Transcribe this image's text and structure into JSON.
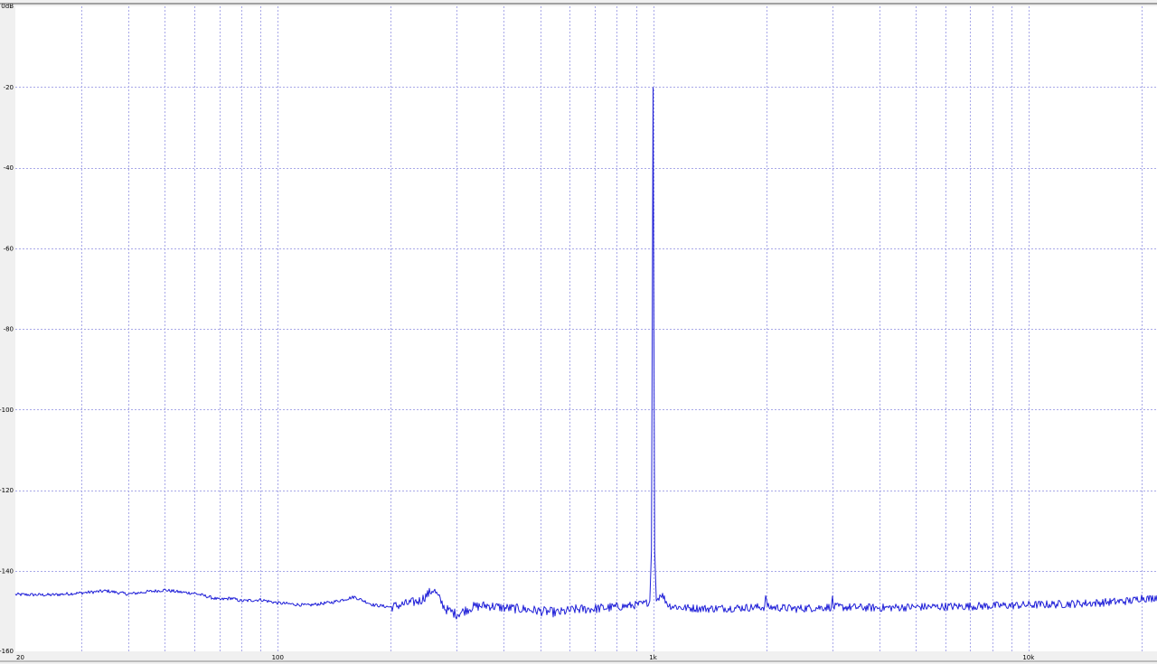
{
  "chart_data": {
    "type": "line",
    "title": "",
    "xlabel": "",
    "ylabel": "",
    "x_scale": "log",
    "xlim": [
      20,
      22000
    ],
    "ylim": [
      -160,
      0
    ],
    "x_ticks": [
      {
        "value": 20,
        "label": "20"
      },
      {
        "value": 100,
        "label": "100"
      },
      {
        "value": 1000,
        "label": "1k"
      },
      {
        "value": 10000,
        "label": "10k"
      }
    ],
    "y_ticks": [
      {
        "value": 0,
        "label": "0dB"
      },
      {
        "value": -20,
        "label": "-20"
      },
      {
        "value": -40,
        "label": "-40"
      },
      {
        "value": -60,
        "label": "-60"
      },
      {
        "value": -80,
        "label": "-80"
      },
      {
        "value": -100,
        "label": "-100"
      },
      {
        "value": -120,
        "label": "-120"
      },
      {
        "value": -140,
        "label": "-140"
      },
      {
        "value": -160,
        "label": "-160"
      }
    ],
    "grid": true,
    "colors": {
      "line": "#2020d8",
      "grid": "#a8a8e8",
      "plot_bg": "#ffffff",
      "frame_bg": "#f0f0f0"
    },
    "series": [
      {
        "values": [
          [
            20,
            -145.9
          ],
          [
            25,
            -146.0
          ],
          [
            30,
            -145.5
          ],
          [
            35,
            -145.0
          ],
          [
            40,
            -145.8
          ],
          [
            45,
            -145.2
          ],
          [
            50,
            -144.8
          ],
          [
            55,
            -145.3
          ],
          [
            60,
            -145.6
          ],
          [
            65,
            -146.4
          ],
          [
            70,
            -147.2
          ],
          [
            75,
            -146.8
          ],
          [
            80,
            -147.5
          ],
          [
            90,
            -147.2
          ],
          [
            100,
            -148.0
          ],
          [
            110,
            -148.3
          ],
          [
            120,
            -148.6
          ],
          [
            140,
            -147.8
          ],
          [
            160,
            -146.5
          ],
          [
            180,
            -148.5
          ],
          [
            200,
            -149.0
          ],
          [
            220,
            -148.2
          ],
          [
            240,
            -147.4
          ],
          [
            260,
            -144.6
          ],
          [
            280,
            -149.5
          ],
          [
            300,
            -150.8
          ],
          [
            330,
            -149.0
          ],
          [
            360,
            -148.6
          ],
          [
            400,
            -149.2
          ],
          [
            450,
            -149.5
          ],
          [
            500,
            -150.0
          ],
          [
            560,
            -150.4
          ],
          [
            620,
            -149.6
          ],
          [
            700,
            -149.4
          ],
          [
            800,
            -149.0
          ],
          [
            880,
            -148.6
          ],
          [
            950,
            -148.2
          ],
          [
            980,
            -147.5
          ],
          [
            990,
            -135.0
          ],
          [
            995,
            -80.0
          ],
          [
            1000,
            -20.2
          ],
          [
            1005,
            -80.0
          ],
          [
            1010,
            -135.0
          ],
          [
            1020,
            -147.5
          ],
          [
            1050,
            -145.6
          ],
          [
            1100,
            -148.6
          ],
          [
            1200,
            -149.2
          ],
          [
            1400,
            -149.4
          ],
          [
            1700,
            -149.2
          ],
          [
            1990,
            -149.0
          ],
          [
            2000,
            -144.0
          ],
          [
            2010,
            -149.0
          ],
          [
            2400,
            -149.4
          ],
          [
            2990,
            -149.0
          ],
          [
            3000,
            -143.5
          ],
          [
            3010,
            -149.0
          ],
          [
            4000,
            -149.2
          ],
          [
            5000,
            -149.0
          ],
          [
            6000,
            -148.9
          ],
          [
            8000,
            -148.7
          ],
          [
            10000,
            -148.5
          ],
          [
            12000,
            -148.3
          ],
          [
            15000,
            -148.0
          ],
          [
            19000,
            -147.4
          ],
          [
            20000,
            -146.6
          ],
          [
            21000,
            -147.0
          ],
          [
            22000,
            -146.4
          ]
        ]
      }
    ]
  }
}
